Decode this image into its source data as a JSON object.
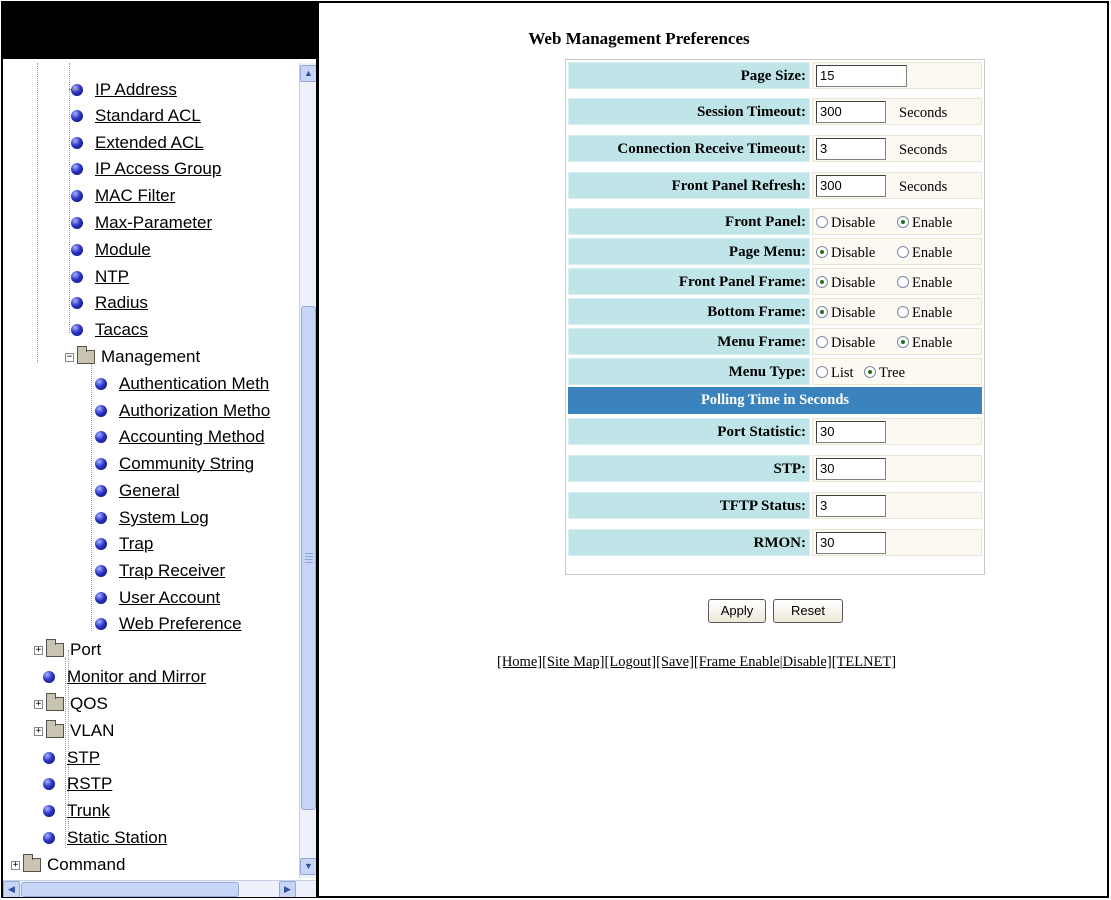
{
  "sidebar": {
    "items": [
      {
        "label": "IP Address",
        "type": "link",
        "level": 2
      },
      {
        "label": "Standard ACL",
        "type": "link",
        "level": 2
      },
      {
        "label": "Extended ACL",
        "type": "link",
        "level": 2
      },
      {
        "label": "IP Access Group",
        "type": "link",
        "level": 2
      },
      {
        "label": "MAC Filter",
        "type": "link",
        "level": 2
      },
      {
        "label": "Max-Parameter",
        "type": "link",
        "level": 2
      },
      {
        "label": "Module",
        "type": "link",
        "level": 2
      },
      {
        "label": "NTP",
        "type": "link",
        "level": 2
      },
      {
        "label": "Radius",
        "type": "link",
        "level": 2
      },
      {
        "label": "Tacacs",
        "type": "link",
        "level": 2
      },
      {
        "label": "Management",
        "type": "folder",
        "level": 1,
        "expanded": true
      },
      {
        "label": "Authentication Meth",
        "type": "link",
        "level": 2
      },
      {
        "label": "Authorization Metho",
        "type": "link",
        "level": 2
      },
      {
        "label": "Accounting Method",
        "type": "link",
        "level": 2
      },
      {
        "label": "Community String",
        "type": "link",
        "level": 2
      },
      {
        "label": "General",
        "type": "link",
        "level": 2
      },
      {
        "label": "System Log",
        "type": "link",
        "level": 2
      },
      {
        "label": "Trap",
        "type": "link",
        "level": 2
      },
      {
        "label": "Trap Receiver",
        "type": "link",
        "level": 2
      },
      {
        "label": "User Account",
        "type": "link",
        "level": 2
      },
      {
        "label": "Web Preference",
        "type": "link",
        "level": 2
      },
      {
        "label": "Port",
        "type": "folder",
        "level": 0,
        "expanded": false
      },
      {
        "label": "Monitor and Mirror",
        "type": "link",
        "level": 0
      },
      {
        "label": "QOS",
        "type": "folder",
        "level": 0,
        "expanded": false
      },
      {
        "label": "VLAN",
        "type": "folder",
        "level": 0,
        "expanded": false
      },
      {
        "label": "STP",
        "type": "link",
        "level": 0
      },
      {
        "label": "RSTP",
        "type": "link",
        "level": 0
      },
      {
        "label": "Trunk",
        "type": "link",
        "level": 0
      },
      {
        "label": "Static Station",
        "type": "link",
        "level": 0
      },
      {
        "label": "Command",
        "type": "folder",
        "level": -1,
        "expanded": false
      }
    ]
  },
  "form": {
    "title": "Web Management Preferences",
    "page_size": {
      "label": "Page Size:",
      "value": "15"
    },
    "session_timeout": {
      "label": "Session Timeout:",
      "value": "300",
      "unit": "Seconds"
    },
    "conn_timeout": {
      "label": "Connection Receive Timeout:",
      "value": "3",
      "unit": "Seconds"
    },
    "fp_refresh": {
      "label": "Front Panel Refresh:",
      "value": "300",
      "unit": "Seconds"
    },
    "front_panel": {
      "label": "Front Panel:",
      "opt1": "Disable",
      "opt2": "Enable",
      "selected": "Enable"
    },
    "page_menu": {
      "label": "Page Menu:",
      "opt1": "Disable",
      "opt2": "Enable",
      "selected": "Disable"
    },
    "fp_frame": {
      "label": "Front Panel Frame:",
      "opt1": "Disable",
      "opt2": "Enable",
      "selected": "Disable"
    },
    "bottom_frame": {
      "label": "Bottom Frame:",
      "opt1": "Disable",
      "opt2": "Enable",
      "selected": "Disable"
    },
    "menu_frame": {
      "label": "Menu Frame:",
      "opt1": "Disable",
      "opt2": "Enable",
      "selected": "Enable"
    },
    "menu_type": {
      "label": "Menu Type:",
      "opt1": "List",
      "opt2": "Tree",
      "selected": "Tree"
    },
    "polling_header": "Polling Time in Seconds",
    "port_statistic": {
      "label": "Port Statistic:",
      "value": "30"
    },
    "stp": {
      "label": "STP:",
      "value": "30"
    },
    "tftp_status": {
      "label": "TFTP Status:",
      "value": "3"
    },
    "rmon": {
      "label": "RMON:",
      "value": "30"
    }
  },
  "buttons": {
    "apply": "Apply",
    "reset": "Reset"
  },
  "footer": {
    "home": "[Home]",
    "site_map": "[Site Map]",
    "logout": "[Logout]",
    "save": "[Save]",
    "frame_enable": "[Frame Enable",
    "sep": "|",
    "disable": "Disable]",
    "telnet": "[TELNET]"
  }
}
